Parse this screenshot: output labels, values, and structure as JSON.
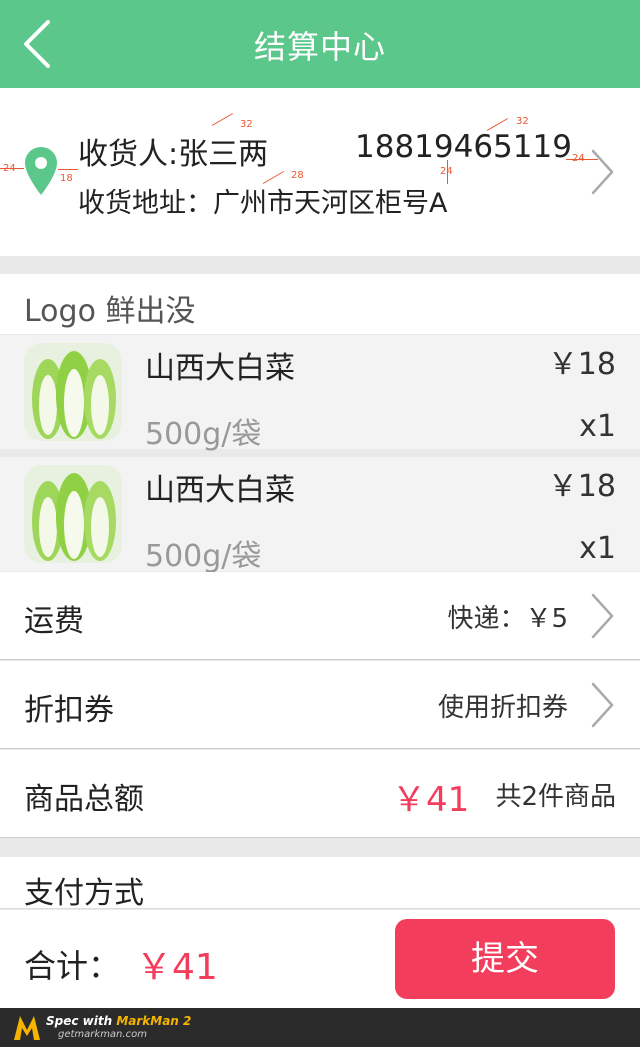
{
  "header": {
    "title": "结算中心"
  },
  "address": {
    "receiver": "收货人:张三两",
    "phone": "18819465119",
    "address": "收货地址：广州市天河区柜号A"
  },
  "annotations": [
    "32",
    "32",
    "24",
    "18",
    "28",
    "24",
    "24"
  ],
  "shop": {
    "name": "Logo 鲜出没"
  },
  "items": [
    {
      "name": "山西大白菜",
      "spec": "500g/袋",
      "price": "￥18",
      "qty": "x1"
    },
    {
      "name": "山西大白菜",
      "spec": "500g/袋",
      "price": "￥18",
      "qty": "x1"
    }
  ],
  "shipping": {
    "label": "运费",
    "value": "快递：￥5"
  },
  "coupon": {
    "label": "折扣券",
    "value": "使用折扣券"
  },
  "subtotal": {
    "label": "商品总额",
    "amount": "￥41",
    "count": "共2件商品"
  },
  "payment": {
    "label": "支付方式"
  },
  "footer": {
    "total_label": "合计：",
    "total_value": "￥41",
    "submit_label": "提交"
  },
  "watermark": {
    "line1_prefix": "Spec with ",
    "line1_brand": "MarkMan 2",
    "line2": "getmarkman.com"
  },
  "colors": {
    "header": "#5cc78b",
    "accent": "#f33d5c",
    "pin": "#5cc78b"
  },
  "icons": {
    "back": "chevron-left-icon",
    "location": "location-pin-icon",
    "arrow": "chevron-right-icon"
  }
}
